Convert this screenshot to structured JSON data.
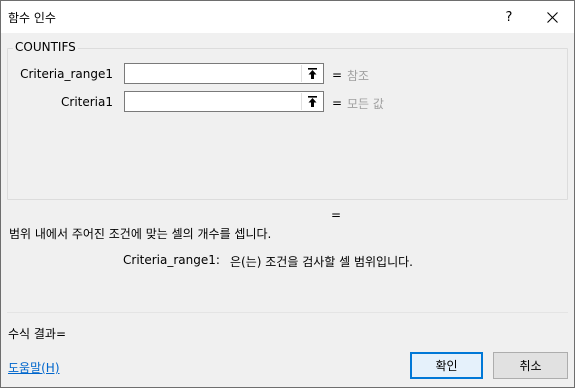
{
  "window": {
    "title": "함수 인수",
    "help_glyph": "?",
    "close_icon": "close-icon"
  },
  "function_name": "COUNTIFS",
  "arguments": [
    {
      "name": "Criteria_range1",
      "value": "",
      "result": "참조"
    },
    {
      "name": "Criteria1",
      "value": "",
      "result": "모든 값"
    }
  ],
  "equals_sign": "=",
  "result_equals": "=",
  "description": "범위 내에서 주어진 조건에 맞는 셀의 개수를 셉니다.",
  "arg_description": {
    "name": "Criteria_range1:",
    "text": "은(는) 조건을 검사할 셀 범위입니다."
  },
  "formula_result_label": "수식 결과=",
  "help_link": "도움말(H)",
  "buttons": {
    "ok": "확인",
    "cancel": "취소"
  },
  "colors": {
    "accent": "#0078d7",
    "link": "#0066cc",
    "muted_text": "#a0a0a0"
  }
}
